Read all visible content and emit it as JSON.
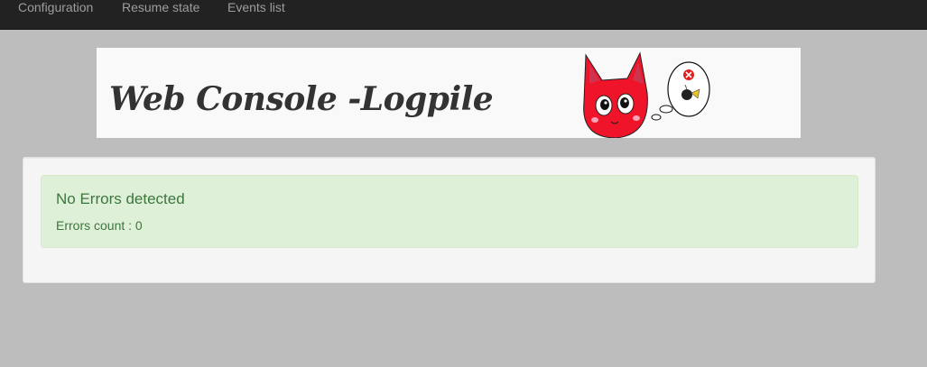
{
  "navbar": {
    "items": [
      {
        "label": "Configuration"
      },
      {
        "label": "Resume state"
      },
      {
        "label": "Events list"
      }
    ]
  },
  "banner": {
    "title": "Web Console -Logpile",
    "mascot_icon": "red-cat-thinking-icon"
  },
  "alert": {
    "heading": "No Errors detected",
    "label": "Errors count",
    "separator": " : ",
    "count": "0"
  },
  "colors": {
    "navbar_bg": "#222222",
    "nav_text": "#9d9d9d",
    "page_bg": "#bdbdbd",
    "alert_bg": "#dff0d8",
    "alert_text": "#3c763d",
    "cat_red": "#f0142a"
  }
}
